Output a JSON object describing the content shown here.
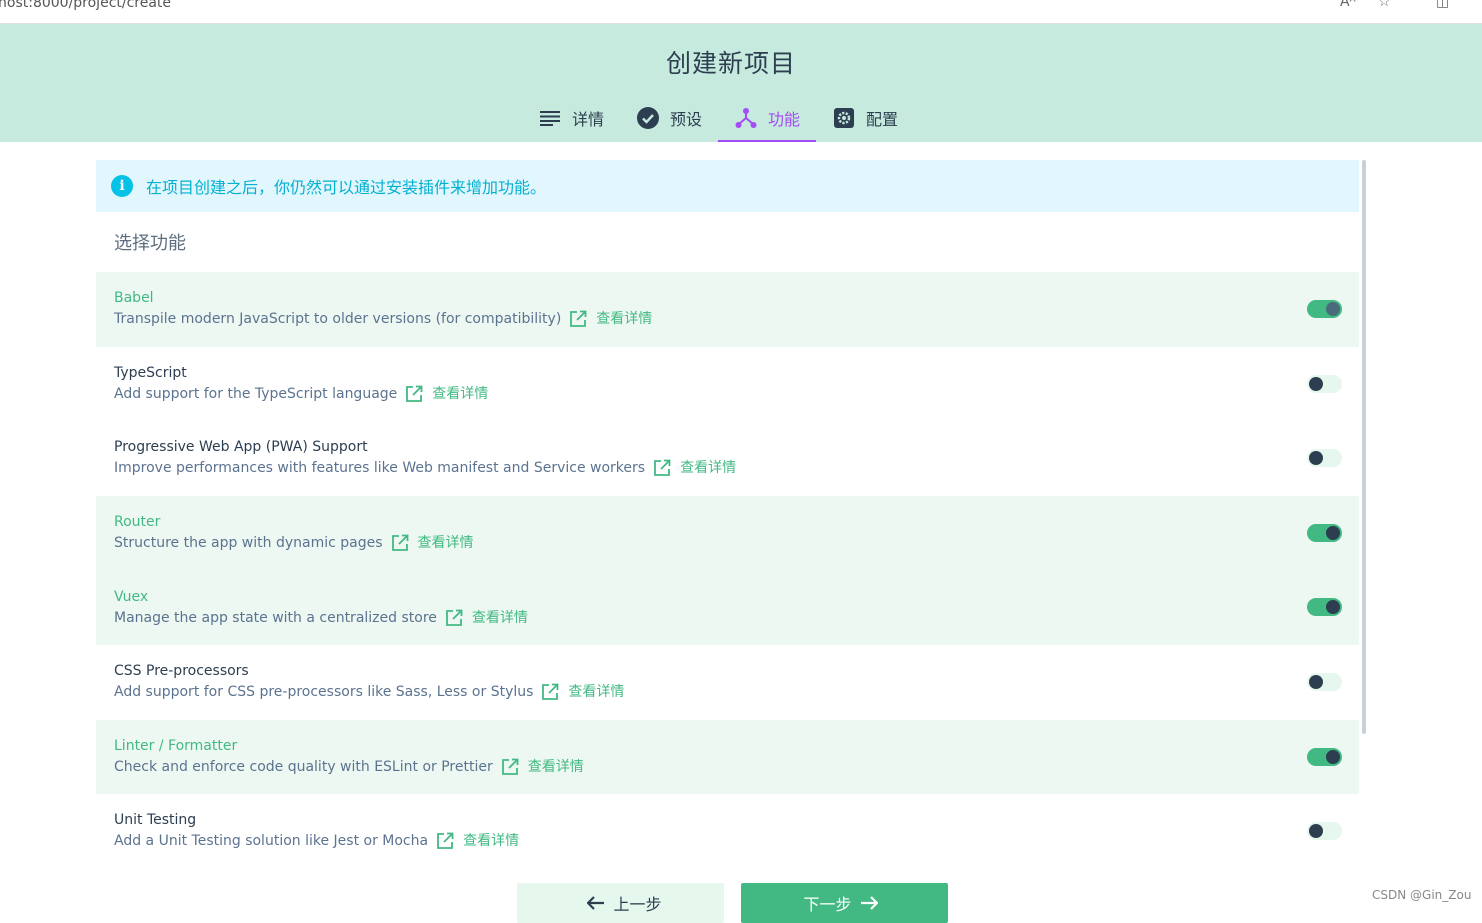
{
  "browser": {
    "url": "host:8000/project/create",
    "read_icon": "Aᴬ"
  },
  "header": {
    "title": "创建新项目",
    "tabs": [
      {
        "label": "详情",
        "icon": "list-icon"
      },
      {
        "label": "预设",
        "icon": "check-circle-icon"
      },
      {
        "label": "功能",
        "icon": "branch-icon",
        "active": true
      },
      {
        "label": "配置",
        "icon": "gear-icon"
      }
    ]
  },
  "info_banner": "在项目创建之后，你仍然可以通过安装插件来增加功能。",
  "section_title": "选择功能",
  "more_label": "查看详情",
  "features": [
    {
      "name": "Babel",
      "desc": "Transpile modern JavaScript to older versions (for compatibility)",
      "enabled": true
    },
    {
      "name": "TypeScript",
      "desc": "Add support for the TypeScript language",
      "enabled": false
    },
    {
      "name": "Progressive Web App (PWA) Support",
      "desc": "Improve performances with features like Web manifest and Service workers",
      "enabled": false
    },
    {
      "name": "Router",
      "desc": "Structure the app with dynamic pages",
      "enabled": true
    },
    {
      "name": "Vuex",
      "desc": "Manage the app state with a centralized store",
      "enabled": true
    },
    {
      "name": "CSS Pre-processors",
      "desc": "Add support for CSS pre-processors like Sass, Less or Stylus",
      "enabled": false
    },
    {
      "name": "Linter / Formatter",
      "desc": "Check and enforce code quality with ESLint or Prettier",
      "enabled": true
    },
    {
      "name": "Unit Testing",
      "desc": "Add a Unit Testing solution like Jest or Mocha",
      "enabled": false
    }
  ],
  "buttons": {
    "prev": "上一步",
    "next": "下一步"
  },
  "watermark": "CSDN @Gin_Zou",
  "colors": {
    "header_bg": "#c6eadd",
    "accent_green": "#42b983",
    "active_tab": "#a44cf6",
    "info": "#03c2e6"
  }
}
